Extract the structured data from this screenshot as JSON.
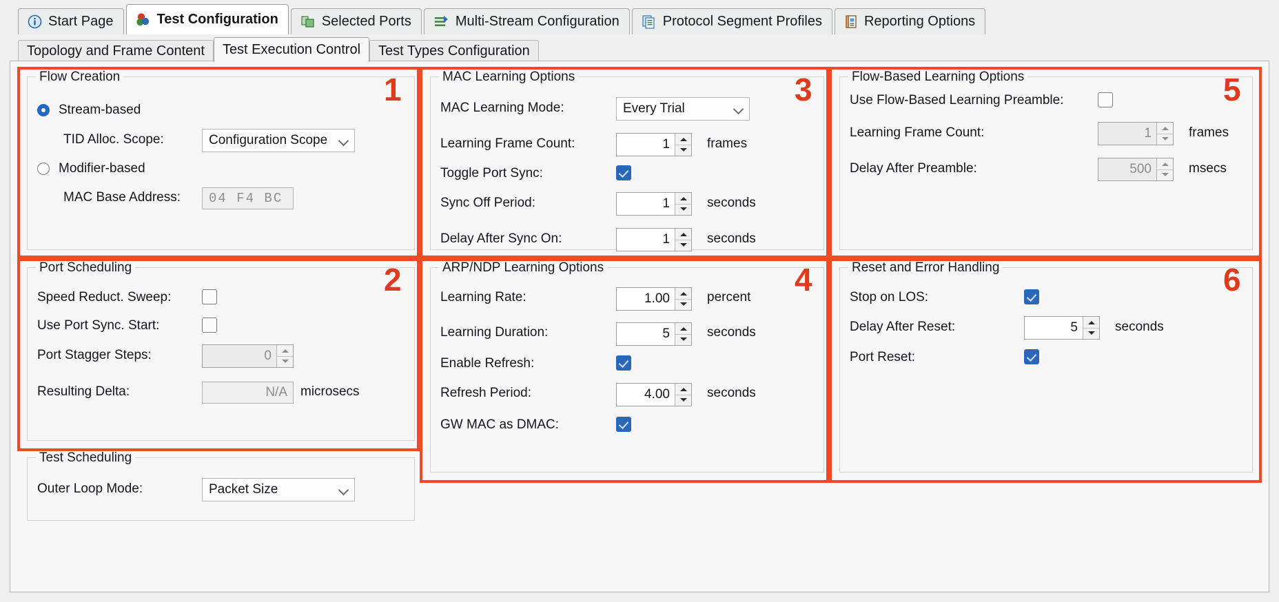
{
  "main_tabs": [
    {
      "label": "Start Page",
      "icon": "info-icon",
      "active": false
    },
    {
      "label": "Test Configuration",
      "icon": "test-config-icon",
      "active": true
    },
    {
      "label": "Selected Ports",
      "icon": "ports-icon",
      "active": false
    },
    {
      "label": "Multi-Stream Configuration",
      "icon": "multistream-icon",
      "active": false
    },
    {
      "label": "Protocol Segment Profiles",
      "icon": "profiles-icon",
      "active": false
    },
    {
      "label": "Reporting Options",
      "icon": "reporting-icon",
      "active": false
    }
  ],
  "sub_tabs": [
    {
      "label": "Topology and Frame Content",
      "active": false
    },
    {
      "label": "Test Execution Control",
      "active": true
    },
    {
      "label": "Test Types Configuration",
      "active": false
    }
  ],
  "annotations": [
    {
      "number": "1"
    },
    {
      "number": "2"
    },
    {
      "number": "3"
    },
    {
      "number": "4"
    },
    {
      "number": "5"
    },
    {
      "number": "6"
    }
  ],
  "flow_creation": {
    "legend": "Flow Creation",
    "stream_based_label": "Stream-based",
    "stream_based_selected": true,
    "tid_alloc_scope_label": "TID Alloc. Scope:",
    "tid_alloc_scope_value": "Configuration Scope",
    "modifier_based_label": "Modifier-based",
    "modifier_based_selected": false,
    "mac_base_address_label": "MAC Base Address:",
    "mac_base_address_value": "04 F4 BC"
  },
  "port_scheduling": {
    "legend": "Port Scheduling",
    "speed_reduct_sweep_label": "Speed Reduct. Sweep:",
    "speed_reduct_sweep_checked": false,
    "use_port_sync_start_label": "Use Port Sync. Start:",
    "use_port_sync_start_checked": false,
    "port_stagger_steps_label": "Port Stagger Steps:",
    "port_stagger_steps_value": "0",
    "resulting_delta_label": "Resulting Delta:",
    "resulting_delta_value": "N/A",
    "resulting_delta_unit": "microsecs"
  },
  "test_scheduling": {
    "legend": "Test Scheduling",
    "outer_loop_mode_label": "Outer Loop Mode:",
    "outer_loop_mode_value": "Packet Size"
  },
  "mac_learning": {
    "legend": "MAC Learning Options",
    "mode_label": "MAC Learning Mode:",
    "mode_value": "Every Trial",
    "frame_count_label": "Learning Frame Count:",
    "frame_count_value": "1",
    "frame_count_unit": "frames",
    "toggle_port_sync_label": "Toggle Port Sync:",
    "toggle_port_sync_checked": true,
    "sync_off_period_label": "Sync Off Period:",
    "sync_off_period_value": "1",
    "sync_off_period_unit": "seconds",
    "delay_after_sync_on_label": "Delay After Sync On:",
    "delay_after_sync_on_value": "1",
    "delay_after_sync_on_unit": "seconds"
  },
  "arp_ndp_learning": {
    "legend": "ARP/NDP Learning Options",
    "learning_rate_label": "Learning Rate:",
    "learning_rate_value": "1.00",
    "learning_rate_unit": "percent",
    "learning_duration_label": "Learning Duration:",
    "learning_duration_value": "5",
    "learning_duration_unit": "seconds",
    "enable_refresh_label": "Enable Refresh:",
    "enable_refresh_checked": true,
    "refresh_period_label": "Refresh Period:",
    "refresh_period_value": "4.00",
    "refresh_period_unit": "seconds",
    "gw_mac_as_dmac_label": "GW MAC as DMAC:",
    "gw_mac_as_dmac_checked": true
  },
  "flow_based_learning": {
    "legend": "Flow-Based Learning Options",
    "use_preamble_label": "Use Flow-Based Learning Preamble:",
    "use_preamble_checked": false,
    "frame_count_label": "Learning Frame Count:",
    "frame_count_value": "1",
    "frame_count_unit": "frames",
    "delay_after_preamble_label": "Delay After Preamble:",
    "delay_after_preamble_value": "500",
    "delay_after_preamble_unit": "msecs"
  },
  "reset_error_handling": {
    "legend": "Reset and Error Handling",
    "stop_on_los_label": "Stop on LOS:",
    "stop_on_los_checked": true,
    "delay_after_reset_label": "Delay After Reset:",
    "delay_after_reset_value": "5",
    "delay_after_reset_unit": "seconds",
    "port_reset_label": "Port Reset:",
    "port_reset_checked": true
  },
  "colors": {
    "annotation": "#ef4a23",
    "accent": "#2a67b8",
    "pane_bg": "#f7f7f7"
  }
}
